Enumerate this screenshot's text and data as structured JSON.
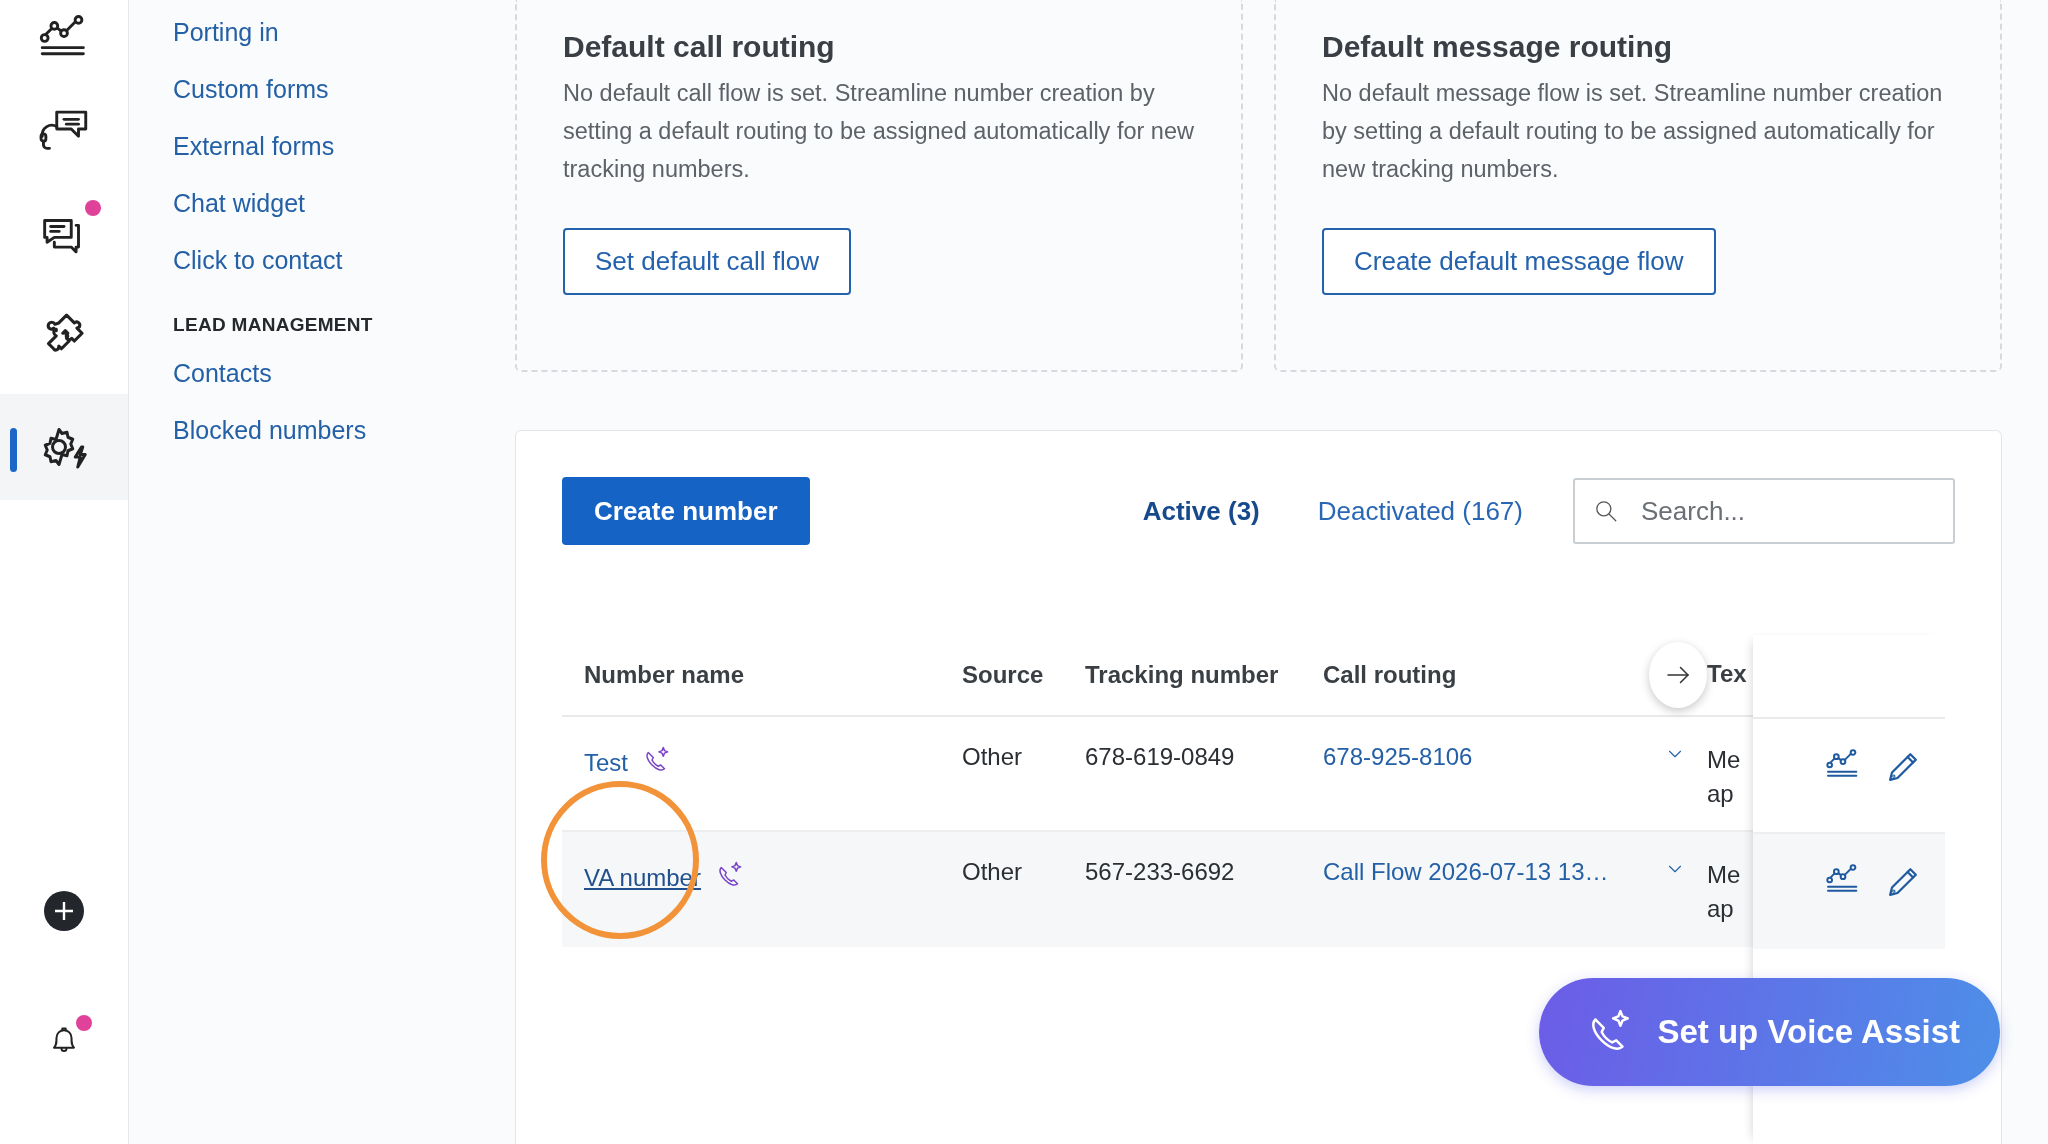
{
  "rail": [
    {
      "kind": "analytics",
      "badge": false,
      "selected": false
    },
    {
      "kind": "headset",
      "badge": false,
      "selected": false
    },
    {
      "kind": "chat",
      "badge": true,
      "selected": false
    },
    {
      "kind": "puzzle",
      "badge": false,
      "selected": false
    },
    {
      "kind": "settings",
      "badge": false,
      "selected": true
    }
  ],
  "rail_bottom": [
    {
      "kind": "add",
      "badge": false
    },
    {
      "kind": "bell",
      "badge": true
    }
  ],
  "nav": [
    {
      "kind": "link",
      "label": "Porting in"
    },
    {
      "kind": "link",
      "label": "Custom forms"
    },
    {
      "kind": "link",
      "label": "External forms"
    },
    {
      "kind": "link",
      "label": "Chat widget"
    },
    {
      "kind": "link",
      "label": "Click to contact"
    },
    {
      "kind": "heading",
      "label": "LEAD MANAGEMENT"
    },
    {
      "kind": "link",
      "label": "Contacts"
    },
    {
      "kind": "link",
      "label": "Blocked numbers"
    }
  ],
  "cards": [
    {
      "title": "Default call routing",
      "text": "No default call flow is set. Streamline number creation by setting a default routing to be assigned automatically for new tracking numbers.",
      "button": "Set default call flow"
    },
    {
      "title": "Default message routing",
      "text": "No default message flow is set. Streamline number creation by setting a default routing to be assigned automatically for new tracking numbers.",
      "button": "Create default message flow"
    }
  ],
  "numbers": {
    "create_button": "Create number",
    "tabs": [
      {
        "label": "Active (3)",
        "selected": true
      },
      {
        "label": "Deactivated (167)",
        "selected": false
      }
    ],
    "search": {
      "placeholder": "Search..."
    },
    "columns": [
      "Number name",
      "Source",
      "Tracking number",
      "Call routing",
      "Tex"
    ],
    "rows": [
      {
        "name": "Test",
        "voice_assist": true,
        "hovered": false,
        "source": "Other",
        "tracking_number": "678-619-0849",
        "call_routing": "678-925-8106",
        "text_routing": "Me ap"
      },
      {
        "name": "VA number",
        "voice_assist": true,
        "hovered": true,
        "source": "Other",
        "tracking_number": "567-233-6692",
        "call_routing": "Call Flow 2026-07-13 13…",
        "text_routing": "Me ap"
      }
    ]
  },
  "voice_assist_button": "Set up Voice Assist"
}
